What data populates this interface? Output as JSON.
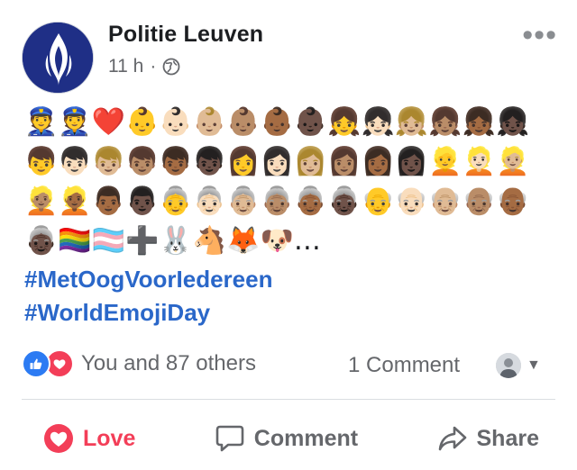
{
  "post": {
    "page_name": "Politie Leuven",
    "time": "11 h",
    "separator": "·",
    "privacy_icon": "globe-icon",
    "more_label": "•••"
  },
  "emoji_rows": [
    "👮👮❤️👶👶🏻👶🏼👶🏽👶🏾👶🏿👧👧🏻👧🏼👧🏽👧🏾👧🏿",
    "👦👦🏻👦🏼👦🏽👦🏾👦🏿👩👩🏻👩🏼👩🏽👩🏾👩🏿👱👱🏻👱🏼",
    "👱🏽👱🏾👨🏾👨🏿👵👵🏻👵🏼👵🏽👵🏾👵🏿👴👴🏻👴🏼👴🏽👴🏾",
    "👵🏿🏳️‍🌈🏳️‍⚧️➕🐰🐴🦊🐶…"
  ],
  "hashtags": [
    "#MetOogVoorIedereen",
    "#WorldEmojiDay"
  ],
  "reactions": {
    "summary": "You and 87 others",
    "comments": "1 Comment"
  },
  "actions": {
    "love": "Love",
    "comment": "Comment",
    "share": "Share"
  },
  "colors": {
    "accent_link": "#2a67c9",
    "love": "#f33e58",
    "like": "#2c7bf3",
    "muted": "#65676b",
    "brand_avatar": "#1f2f86"
  }
}
